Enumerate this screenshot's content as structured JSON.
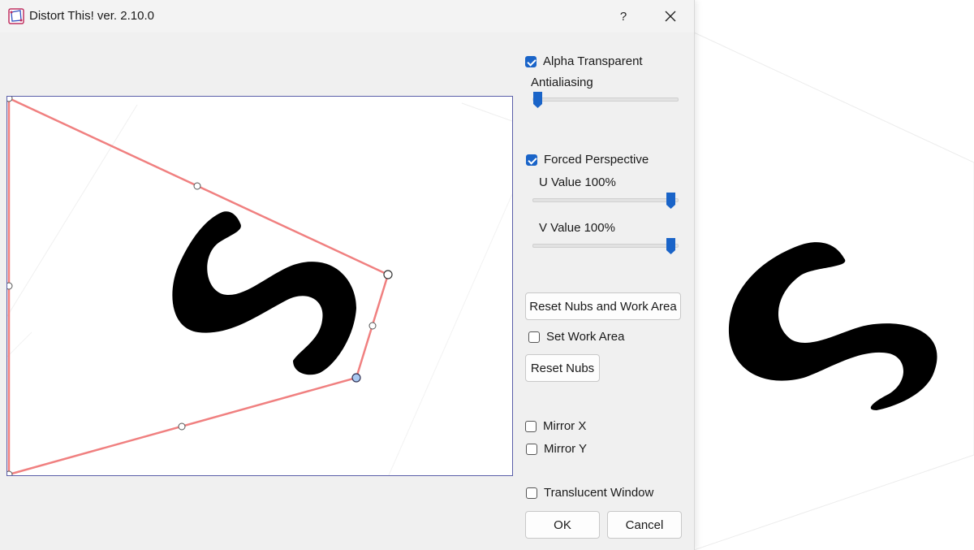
{
  "window": {
    "title": "Distort This! ver. 2.10.0",
    "help_label": "?",
    "close_label": "✕"
  },
  "options": {
    "alpha_transparent": {
      "label": "Alpha Transparent",
      "checked": true
    },
    "antialiasing": {
      "label": "Antialiasing",
      "value": 0
    },
    "forced_perspective": {
      "label": "Forced Perspective",
      "checked": true
    },
    "u_value": {
      "label": "U Value 100%",
      "value": 1.0
    },
    "v_value": {
      "label": "V Value 100%",
      "value": 1.0
    },
    "reset_nubs_work_area_label": "Reset Nubs and Work Area",
    "set_work_area": {
      "label": "Set Work Area",
      "checked": false
    },
    "reset_nubs_label": "Reset Nubs",
    "mirror_x": {
      "label": "Mirror X",
      "checked": false
    },
    "mirror_y": {
      "label": "Mirror Y",
      "checked": false
    },
    "translucent_window": {
      "label": "Translucent Window",
      "checked": false
    }
  },
  "footer": {
    "ok_label": "OK",
    "cancel_label": "Cancel"
  },
  "colors": {
    "accent": "#1a64c8",
    "outline": "#f08080",
    "frame": "#5a5ea8",
    "selected_nub": "#a8c8f0"
  },
  "preview": {
    "glyph": "S"
  }
}
